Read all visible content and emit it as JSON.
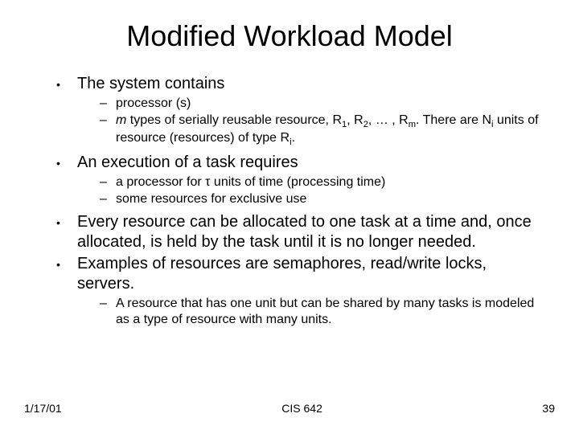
{
  "title": "Modified Workload Model",
  "bullets": {
    "b1": "The system contains",
    "b1s1": "processor (s)",
    "b1s2_pre": "",
    "b1s2_m": "m",
    "b1s2_mid": " types of serially reusable resource, R",
    "b1s2_sub1": "1",
    "b1s2_c1": ", R",
    "b1s2_sub2": "2",
    "b1s2_c2": ", … , R",
    "b1s2_subm": "m",
    "b1s2_after": ". There are N",
    "b1s2_subi": "i",
    "b1s2_tail1": " units of resource (resources) of type R",
    "b1s2_subi2": "i",
    "b1s2_dot": ".",
    "b2": "An execution of a task requires",
    "b2s1_pre": "a processor for ",
    "b2s1_tau": "τ",
    "b2s1_post": " units of time (processing time)",
    "b2s2": "some resources for exclusive use",
    "b3": "Every resource can be allocated to one task at a time and, once allocated, is held by the task until it is no longer needed.",
    "b4": "Examples of resources are semaphores, read/write locks, servers.",
    "b4s1": "A resource that has one unit but can be shared by many tasks is modeled as a type of resource with many units."
  },
  "footer": {
    "date": "1/17/01",
    "center": "CIS 642",
    "page": "39"
  }
}
